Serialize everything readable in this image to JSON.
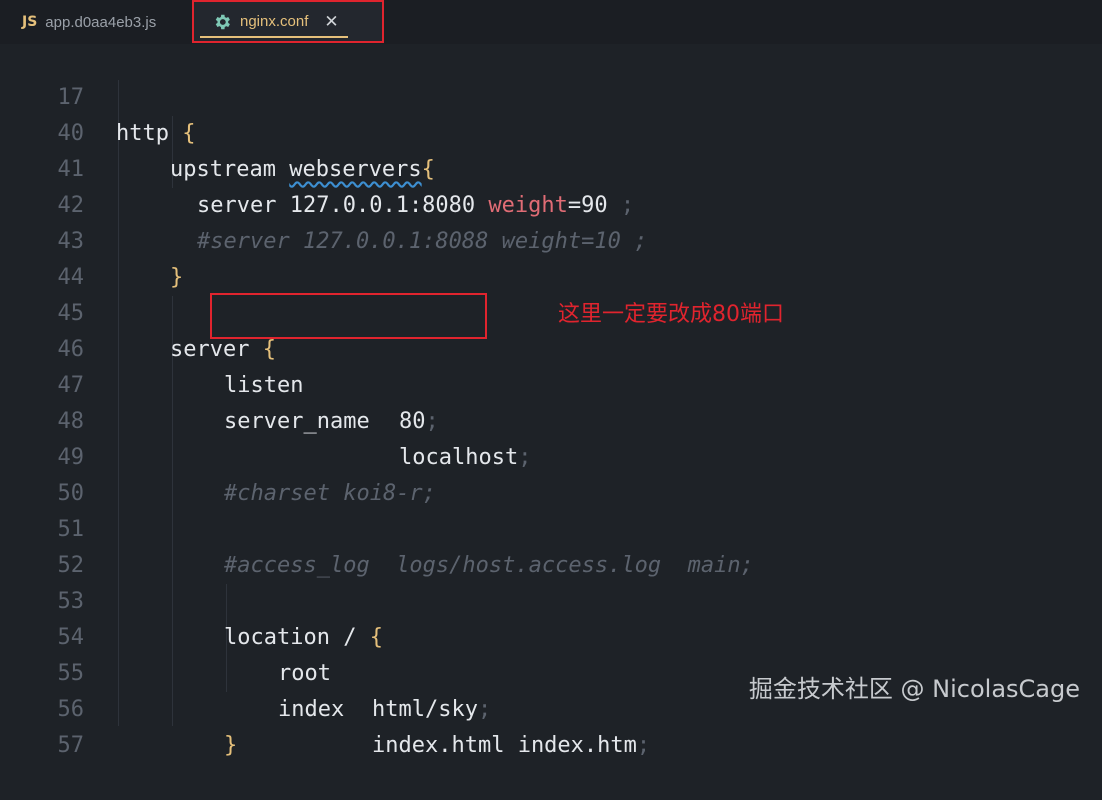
{
  "tabs": [
    {
      "badge": "JS",
      "label": "app.d0aa4eb3.js"
    },
    {
      "icon": "gear-icon",
      "label": "nginx.conf",
      "close": "✕"
    }
  ],
  "lines": [
    {
      "num": "17"
    },
    {
      "num": "40"
    },
    {
      "num": "41"
    },
    {
      "num": "42"
    },
    {
      "num": "43"
    },
    {
      "num": "44"
    },
    {
      "num": "45"
    },
    {
      "num": "46"
    },
    {
      "num": "47"
    },
    {
      "num": "48"
    },
    {
      "num": "49"
    },
    {
      "num": "50"
    },
    {
      "num": "51"
    },
    {
      "num": "52"
    },
    {
      "num": "53"
    },
    {
      "num": "54"
    },
    {
      "num": "55"
    },
    {
      "num": "56"
    },
    {
      "num": "57"
    }
  ],
  "code": {
    "http": "http",
    "upstream": "upstream",
    "webservers": "webservers",
    "server_kw": "server",
    "server_addr": "127.0.0.1:8080",
    "weight_kw": "weight",
    "weight_eq": "=90",
    "semicolon": " ;",
    "comment_server": "#server 127.0.0.1:8088 weight=10 ;",
    "listen": "listen",
    "listen_val": "80",
    "server_name": "server_name",
    "server_name_val": "localhost",
    "comment_charset": "#charset koi8-r;",
    "comment_access": "#access_log  logs/host.access.log  main;",
    "location": "location / ",
    "root": "root",
    "root_val": "html/sky",
    "index": "index",
    "index_val": "index.html index.htm"
  },
  "annotation": "这里一定要改成80端口",
  "watermark": "掘金技术社区 @ NicolasCage",
  "colors": {
    "highlight_box": "#e0242e",
    "tab_accent": "#e5c07b"
  }
}
